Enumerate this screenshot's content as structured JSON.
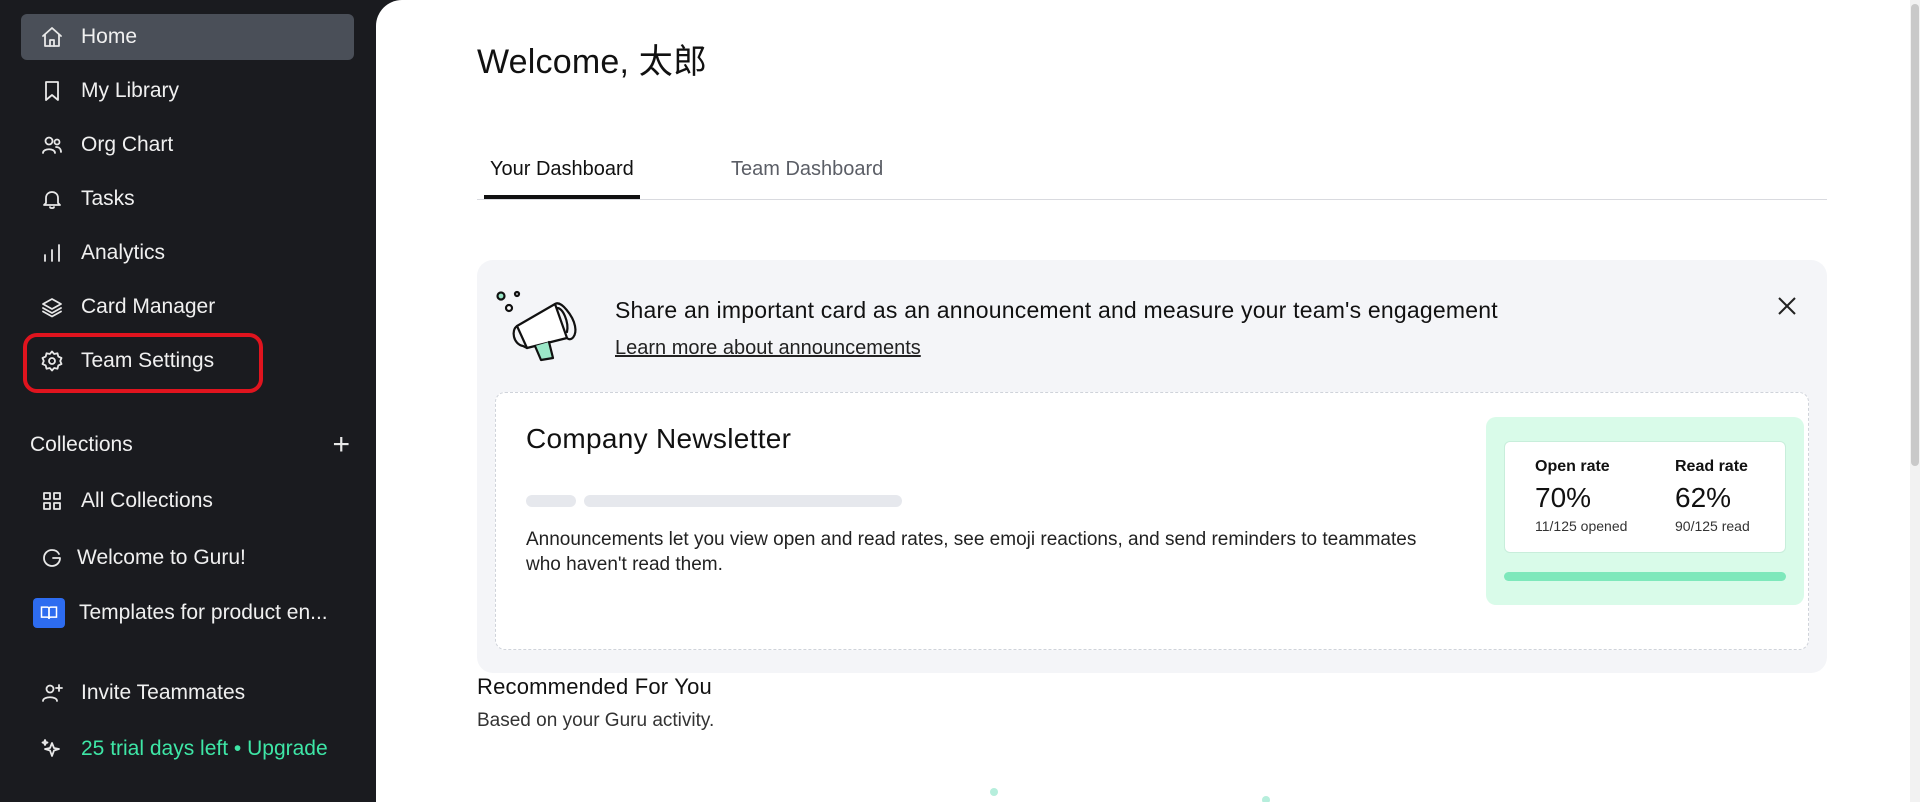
{
  "sidebar": {
    "items": [
      {
        "label": "Home",
        "icon": "home-icon"
      },
      {
        "label": "My Library",
        "icon": "bookmark-icon"
      },
      {
        "label": "Org Chart",
        "icon": "people-icon"
      },
      {
        "label": "Tasks",
        "icon": "bell-icon"
      },
      {
        "label": "Analytics",
        "icon": "bar-chart-icon"
      },
      {
        "label": "Card Manager",
        "icon": "layers-icon"
      },
      {
        "label": "Team Settings",
        "icon": "gear-icon"
      }
    ],
    "collections_label": "Collections",
    "collections": [
      {
        "label": "All Collections",
        "icon": "grid-icon"
      },
      {
        "label": "Welcome to Guru!",
        "icon": "guru-logo-icon"
      },
      {
        "label": "Templates for product en...",
        "icon": "book-icon"
      }
    ],
    "invite_label": "Invite Teammates",
    "trial_label": "25 trial days left • Upgrade"
  },
  "main": {
    "welcome": "Welcome, 太郎",
    "tabs": [
      {
        "label": "Your Dashboard",
        "active": true
      },
      {
        "label": "Team Dashboard",
        "active": false
      }
    ],
    "announcement": {
      "title": "Share an important card as an announcement and measure your team's engagement",
      "link": "Learn more about announcements",
      "card": {
        "title": "Company Newsletter",
        "description": "Announcements let you view open and read rates, see emoji reactions, and send reminders to teammates who haven't read them.",
        "open_rate_label": "Open rate",
        "open_rate_value": "70%",
        "open_rate_sub": "11/125 opened",
        "read_rate_label": "Read rate",
        "read_rate_value": "62%",
        "read_rate_sub": "90/125 read"
      }
    },
    "recommended_title": "Recommended For You",
    "recommended_sub": "Based on your Guru activity."
  },
  "colors": {
    "sidebar_bg": "#1a1b1f",
    "active_item_bg": "#4a4f58",
    "highlight_ring": "#e0141e",
    "trial_text": "#3ee6a6",
    "stats_bg": "#d9fbe9"
  }
}
